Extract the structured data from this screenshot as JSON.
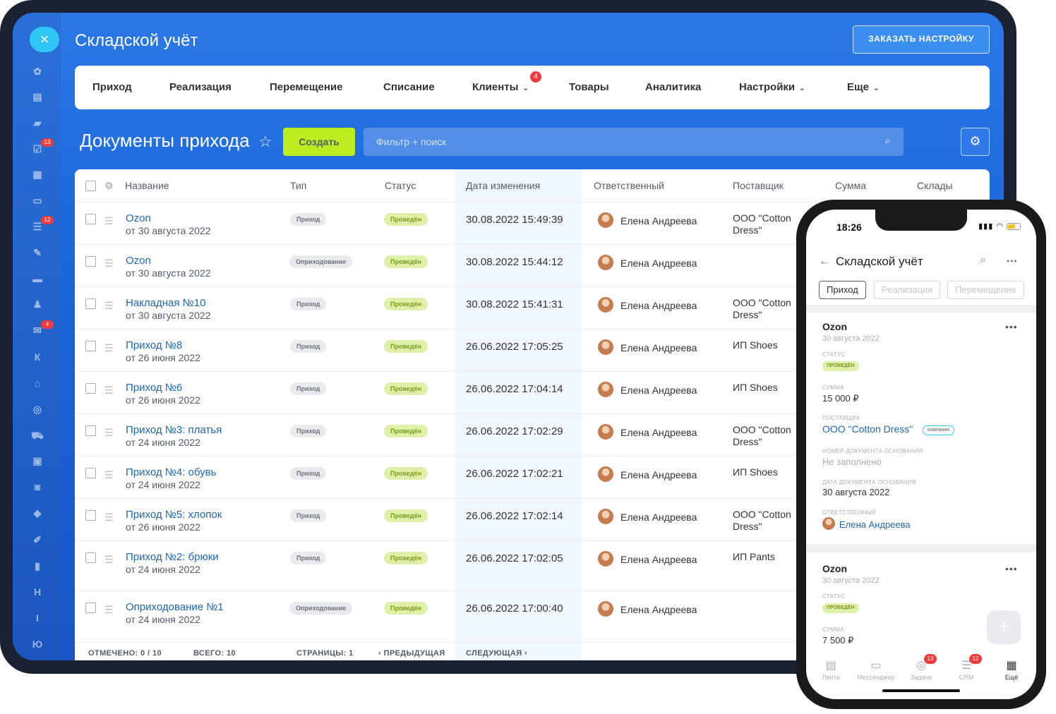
{
  "app": {
    "title": "Складской учёт",
    "order_button": "ЗАКАЗАТЬ НАСТРОЙКУ",
    "close_glyph": "×"
  },
  "sidebar_badges": {
    "tasks": "13",
    "crm": "12",
    "mail": "4"
  },
  "sidebar_letters": {
    "k": "К",
    "h": "Н",
    "i": "I",
    "yu": "Ю"
  },
  "nav": {
    "items": [
      "Приход",
      "Реализация",
      "Перемещение",
      "Списание",
      "Клиенты",
      "Товары",
      "Аналитика",
      "Настройки",
      "Еще"
    ],
    "clients_badge": "4"
  },
  "page": {
    "title": "Документы прихода",
    "create_button": "Создать",
    "filter_placeholder": "Фильтр + поиск"
  },
  "table": {
    "headers": {
      "name": "Название",
      "type": "Тип",
      "status": "Статус",
      "date": "Дата изменения",
      "responsible": "Ответственный",
      "supplier": "Поставщик",
      "sum": "Сумма",
      "warehouses": "Склады"
    },
    "rows": [
      {
        "name": "Ozon",
        "sub": "от 30 августа 2022",
        "type": "Приход",
        "status": "Проведён",
        "date": "30.08.2022 15:49:39",
        "responsible": "Елена Андреева",
        "supplier": "ООО \"Cotton Dress\""
      },
      {
        "name": "Ozon",
        "sub": "от 30 августа 2022",
        "type": "Оприходование",
        "status": "Проведён",
        "date": "30.08.2022 15:44:12",
        "responsible": "Елена Андреева",
        "supplier": ""
      },
      {
        "name": "Накладная №10",
        "sub": "от 30 августа 2022",
        "type": "Приход",
        "status": "Проведён",
        "date": "30.08.2022 15:41:31",
        "responsible": "Елена Андреева",
        "supplier": "ООО \"Cotton Dress\""
      },
      {
        "name": "Приход №8",
        "sub": "от 26 июня 2022",
        "type": "Приход",
        "status": "Проведён",
        "date": "26.06.2022 17:05:25",
        "responsible": "Елена Андреева",
        "supplier": "ИП Shoes"
      },
      {
        "name": "Приход №6",
        "sub": "от 26 июня 2022",
        "type": "Приход",
        "status": "Проведён",
        "date": "26.06.2022 17:04:14",
        "responsible": "Елена Андреева",
        "supplier": "ИП Shoes"
      },
      {
        "name": "Приход №3: платья",
        "sub": "от 24 июня 2022",
        "type": "Приход",
        "status": "Проведён",
        "date": "26.06.2022 17:02:29",
        "responsible": "Елена Андреева",
        "supplier": "ООО \"Cotton Dress\""
      },
      {
        "name": "Приход №4: обувь",
        "sub": "от 24 июня 2022",
        "type": "Приход",
        "status": "Проведён",
        "date": "26.06.2022 17:02:21",
        "responsible": "Елена Андреева",
        "supplier": "ИП Shoes"
      },
      {
        "name": "Приход №5: хлопок",
        "sub": "от 26 июня 2022",
        "type": "Приход",
        "status": "Проведён",
        "date": "26.06.2022 17:02:14",
        "responsible": "Елена Андреева",
        "supplier": "ООО \"Cotton Dress\""
      },
      {
        "name": "Приход №2: брюки",
        "sub": "от 24 июня 2022",
        "type": "Приход",
        "status": "Проведён",
        "date": "26.06.2022 17:02:05",
        "responsible": "Елена Андреева",
        "supplier": "ИП Pants"
      },
      {
        "name": "Оприходование №1",
        "sub": "от 24 июня 2022",
        "type": "Оприходование",
        "status": "Проведён",
        "date": "26.06.2022 17:00:40",
        "responsible": "Елена Андреева",
        "supplier": ""
      }
    ]
  },
  "footer": {
    "selected": "ОТМЕЧЕНО: 0 / 10",
    "total": "ВСЕГО: 10",
    "pages": "СТРАНИЦЫ: 1",
    "prev": "‹ ПРЕДЫДУЩАЯ",
    "next": "СЛЕДУЮЩАЯ ›"
  },
  "phone": {
    "time": "18:26",
    "title": "Складской учёт",
    "tabs": [
      "Приход",
      "Реализация",
      "Перемещение"
    ],
    "cards": [
      {
        "title": "Ozon",
        "date": "30 августа 2022",
        "status_label": "СТАТУС",
        "status": "ПРОВЕДЁН",
        "sum_label": "СУММА",
        "sum": "15 000 ₽",
        "supplier_label": "ПОСТАВЩИК",
        "supplier": "ООО \"Cotton Dress\"",
        "supplier_tag": "компания",
        "basis_num_label": "НОМЕР ДОКУМЕНТА ОСНОВАНИЯ",
        "basis_num": "Не заполнено",
        "basis_date_label": "ДАТА ДОКУМЕНТА ОСНОВАНИЯ",
        "basis_date": "30 августа 2022",
        "responsible_label": "ОТВЕТСТВЕННЫЙ",
        "responsible": "Елена Андреева"
      },
      {
        "title": "Ozon",
        "date": "30 августа 2022",
        "status_label": "СТАТУС",
        "status": "ПРОВЕДЁН",
        "sum_label": "СУММА",
        "sum": "7 500 ₽"
      }
    ],
    "tabbar": [
      {
        "label": "Лента",
        "icon": "feed-icon"
      },
      {
        "label": "Мессенджер",
        "icon": "messenger-icon"
      },
      {
        "label": "Задачи",
        "icon": "tasks-icon",
        "badge": "13"
      },
      {
        "label": "CRM",
        "icon": "crm-icon",
        "badge": "12"
      },
      {
        "label": "Ещё",
        "icon": "grid-icon"
      }
    ]
  }
}
